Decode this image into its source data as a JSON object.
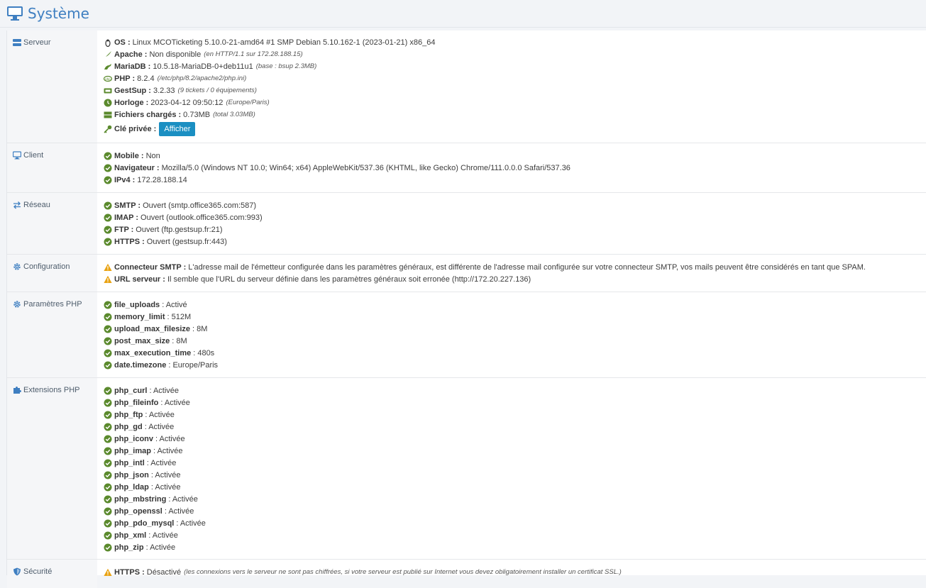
{
  "page": {
    "title": "Système"
  },
  "server": {
    "label": "Serveur",
    "os": {
      "key": "OS :",
      "value": "Linux MCOTicketing 5.10.0-21-amd64 #1 SMP Debian 5.10.162-1 (2023-01-21) x86_64"
    },
    "apache": {
      "key": "Apache :",
      "value": "Non disponible",
      "note": "(en HTTP/1.1 sur 172.28.188.15)"
    },
    "mariadb": {
      "key": "MariaDB :",
      "value": "10.5.18-MariaDB-0+deb11u1",
      "note": "(base : bsup 2.3MB)"
    },
    "php": {
      "key": "PHP :",
      "value": "8.2.4",
      "note": "(/etc/php/8.2/apache2/php.ini)"
    },
    "gestsup": {
      "key": "GestSup :",
      "value": "3.2.33",
      "note": "(9 tickets / 0 équipements)"
    },
    "clock": {
      "key": "Horloge :",
      "value": "2023-04-12 09:50:12",
      "note": "(Europe/Paris)"
    },
    "files": {
      "key": "Fichiers chargés :",
      "value": "0.73MB",
      "note": "(total 3.03MB)"
    },
    "key": {
      "key": "Clé privée :",
      "button": "Afficher"
    }
  },
  "client": {
    "label": "Client",
    "items": [
      {
        "key": "Mobile :",
        "value": "Non"
      },
      {
        "key": "Navigateur :",
        "value": "Mozilla/5.0 (Windows NT 10.0; Win64; x64) AppleWebKit/537.36 (KHTML, like Gecko) Chrome/111.0.0.0 Safari/537.36"
      },
      {
        "key": "IPv4 :",
        "value": "172.28.188.14"
      }
    ]
  },
  "network": {
    "label": "Réseau",
    "items": [
      {
        "key": "SMTP :",
        "value": "Ouvert (smtp.office365.com:587)"
      },
      {
        "key": "IMAP :",
        "value": "Ouvert (outlook.office365.com:993)"
      },
      {
        "key": "FTP :",
        "value": "Ouvert (ftp.gestsup.fr:21)"
      },
      {
        "key": "HTTPS :",
        "value": "Ouvert (gestsup.fr:443)"
      }
    ]
  },
  "configuration": {
    "label": "Configuration",
    "items": [
      {
        "key": "Connecteur SMTP :",
        "value": "L'adresse mail de l'émetteur configurée dans les paramètres généraux, est différente de l'adresse mail configurée sur votre connecteur SMTP, vos mails peuvent être considérés en tant que SPAM."
      },
      {
        "key": "URL serveur :",
        "value": "Il semble que l'URL du serveur définie dans les paramètres généraux soit erronée (http://172.20.227.136)"
      }
    ]
  },
  "php_params": {
    "label": "Paramètres PHP",
    "items": [
      {
        "key": "file_uploads",
        "value": ": Activé"
      },
      {
        "key": "memory_limit",
        "value": ": 512M"
      },
      {
        "key": "upload_max_filesize",
        "value": ": 8M"
      },
      {
        "key": "post_max_size",
        "value": ": 8M"
      },
      {
        "key": "max_execution_time",
        "value": ": 480s"
      },
      {
        "key": "date.timezone",
        "value": ": Europe/Paris"
      }
    ]
  },
  "php_ext": {
    "label": "Extensions PHP",
    "items": [
      {
        "key": "php_curl",
        "value": ": Activée"
      },
      {
        "key": "php_fileinfo",
        "value": ": Activée"
      },
      {
        "key": "php_ftp",
        "value": ": Activée"
      },
      {
        "key": "php_gd",
        "value": ": Activée"
      },
      {
        "key": "php_iconv",
        "value": ": Activée"
      },
      {
        "key": "php_imap",
        "value": ": Activée"
      },
      {
        "key": "php_intl",
        "value": ": Activée"
      },
      {
        "key": "php_json",
        "value": ": Activée"
      },
      {
        "key": "php_ldap",
        "value": ": Activée"
      },
      {
        "key": "php_mbstring",
        "value": ": Activée"
      },
      {
        "key": "php_openssl",
        "value": ": Activée"
      },
      {
        "key": "php_pdo_mysql",
        "value": ": Activée"
      },
      {
        "key": "php_xml",
        "value": ": Activée"
      },
      {
        "key": "php_zip",
        "value": ": Activée"
      }
    ]
  },
  "security": {
    "label": "Sécurité",
    "items": [
      {
        "key": "HTTPS :",
        "value": "Désactivé",
        "note": "(les connexions vers le serveur ne sont pas chiffrées, si votre serveur est publié sur Internet vous devez obligatoirement installer un certificat SSL.)"
      }
    ]
  },
  "colors": {
    "accent": "#3f7fc1",
    "ok": "#5b8a2d",
    "warn": "#e9a313",
    "button": "#1b8fc2"
  }
}
